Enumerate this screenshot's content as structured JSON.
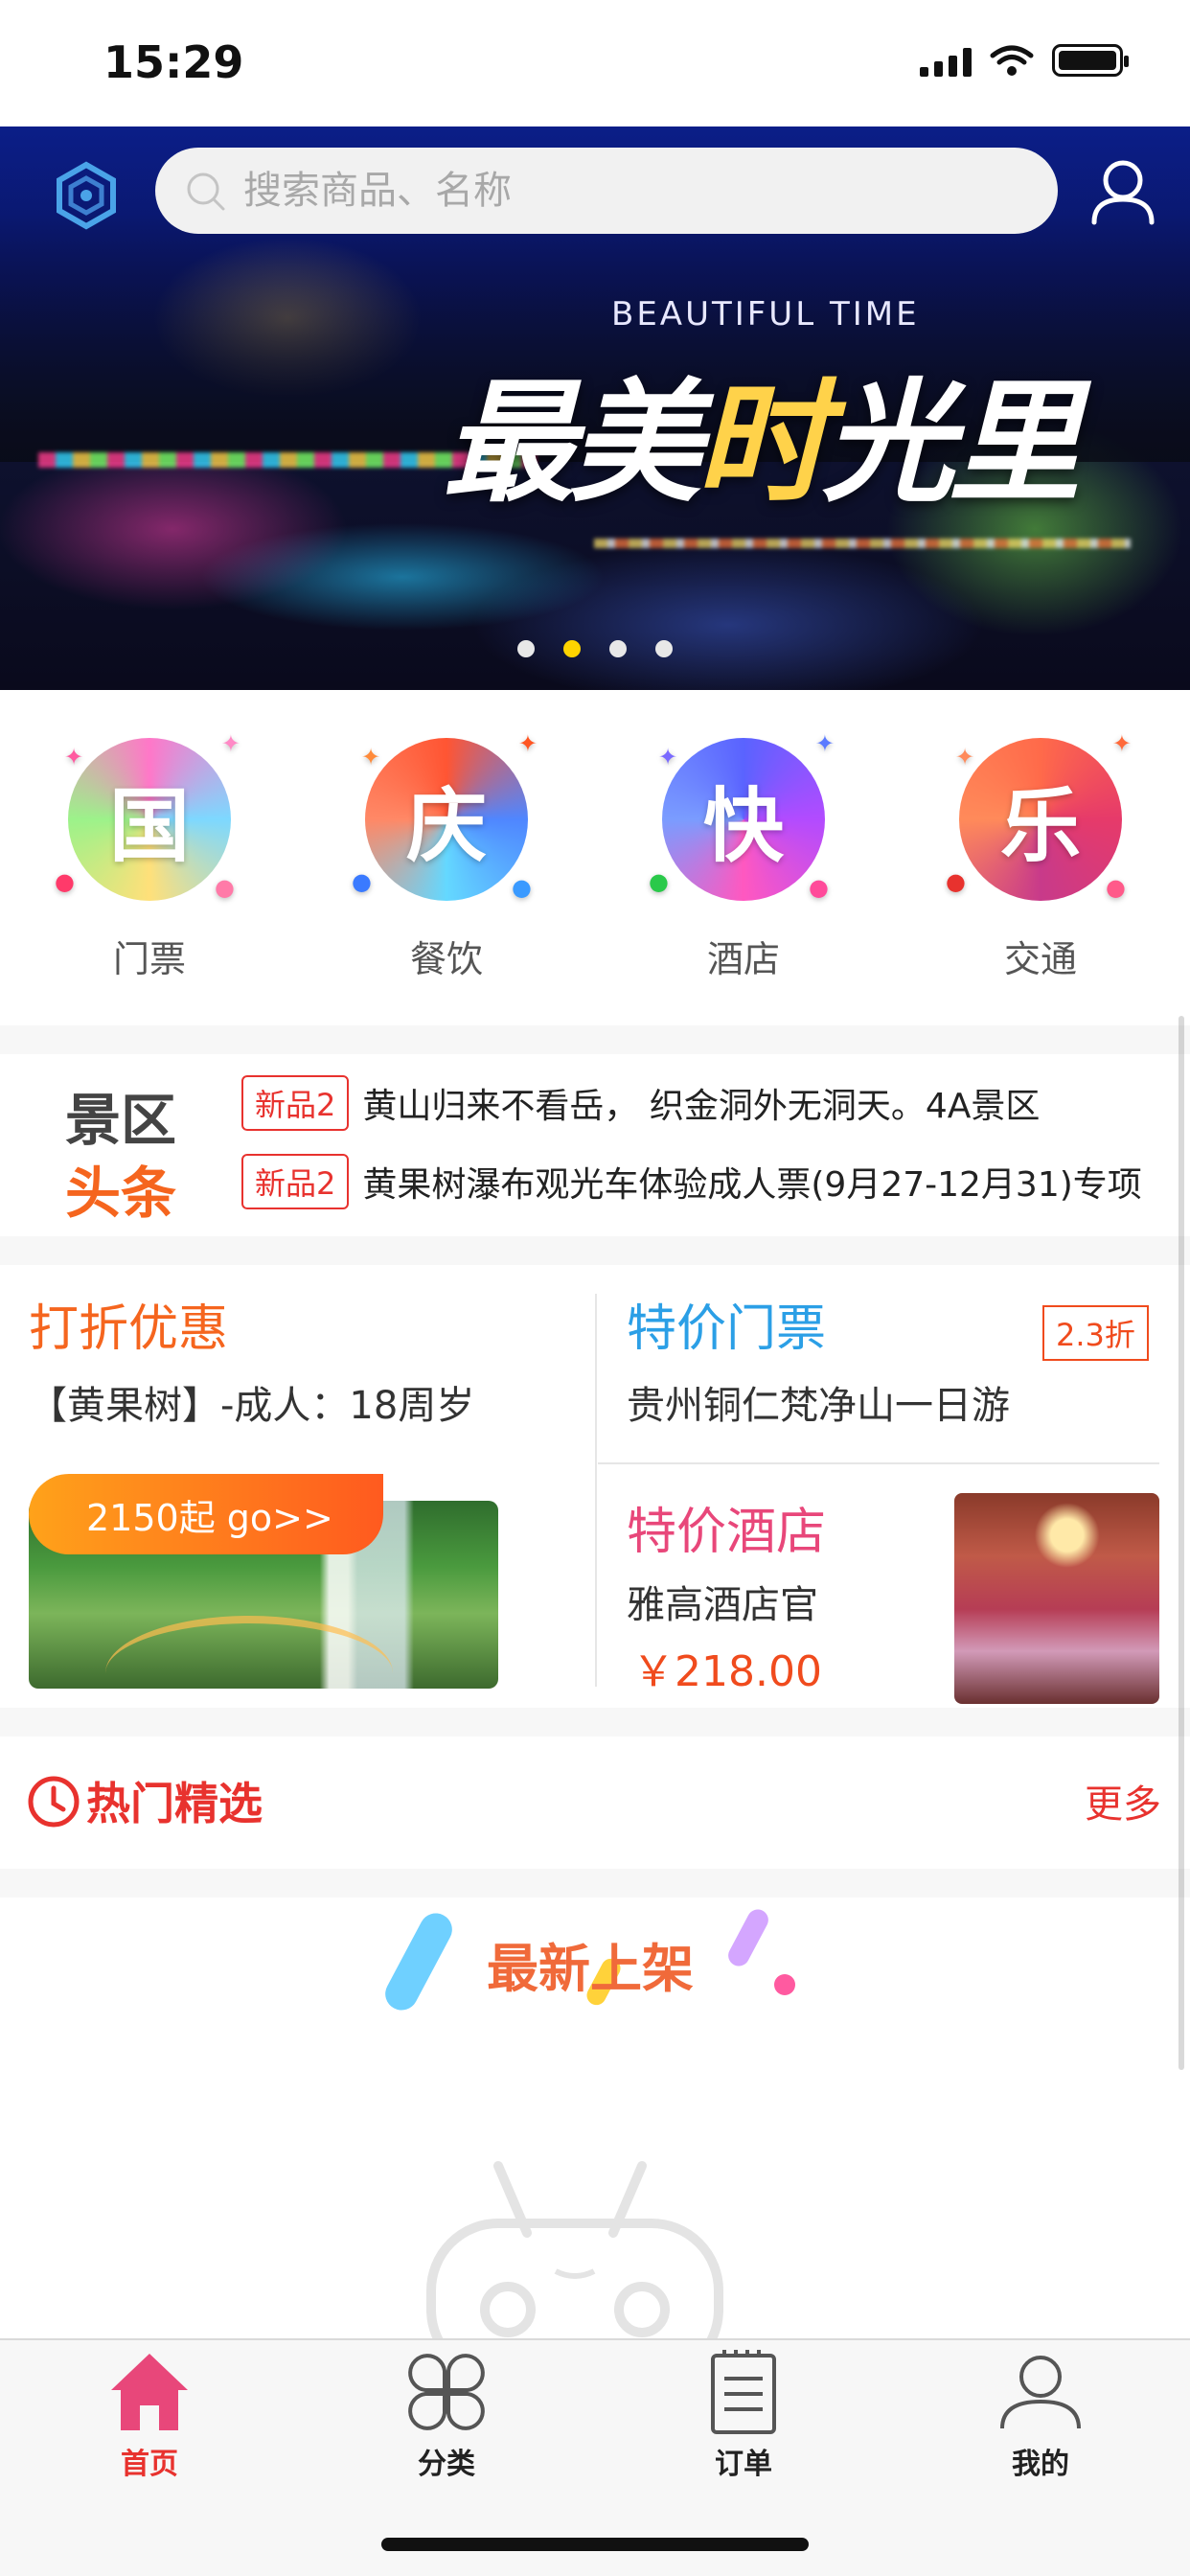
{
  "status": {
    "time": "15:29"
  },
  "search": {
    "placeholder": "搜索商品、名称"
  },
  "banner": {
    "subtitle": "BEAUTIFUL TIME",
    "title_a": "最美",
    "title_b": "时",
    "title_c": "光里",
    "active_dot": 2,
    "dot_count": 4
  },
  "categories": [
    {
      "glyph": "国",
      "label": "门票"
    },
    {
      "glyph": "庆",
      "label": "餐饮"
    },
    {
      "glyph": "快",
      "label": "酒店"
    },
    {
      "glyph": "乐",
      "label": "交通"
    }
  ],
  "headlines": {
    "title_line1": "景区",
    "title_line2": "头条",
    "items": [
      {
        "tag": "新品2",
        "text": "黄山归来不看岳， 织金洞外无洞天。4A景区"
      },
      {
        "tag": "新品2",
        "text": "黄果树瀑布观光车体验成人票(9月27-12月31)专项"
      }
    ]
  },
  "deals": {
    "discount": {
      "heading": "打折优惠",
      "subtitle": "【黄果树】-成人：18周岁",
      "price_pill": "2150起 go>>"
    },
    "ticket": {
      "heading": "特价门票",
      "subtitle": "贵州铜仁梵净山一日游",
      "badge": "2.3折"
    },
    "hotel": {
      "heading": "特价酒店",
      "subtitle": "雅高酒店官",
      "price": "￥218.00"
    }
  },
  "hot": {
    "title": "热门精选",
    "more": "更多"
  },
  "new_arrivals": {
    "title": "最新上架"
  },
  "tabs": [
    {
      "label": "首页",
      "icon": "home-icon",
      "active": true
    },
    {
      "label": "分类",
      "icon": "category-icon",
      "active": false
    },
    {
      "label": "订单",
      "icon": "order-icon",
      "active": false
    },
    {
      "label": "我的",
      "icon": "profile-icon",
      "active": false
    }
  ],
  "colors": {
    "accent": "#e8322e",
    "orange": "#f5651e",
    "blue": "#2b9fe6",
    "pink": "#e8477a",
    "dot_active": "#ffd400"
  }
}
